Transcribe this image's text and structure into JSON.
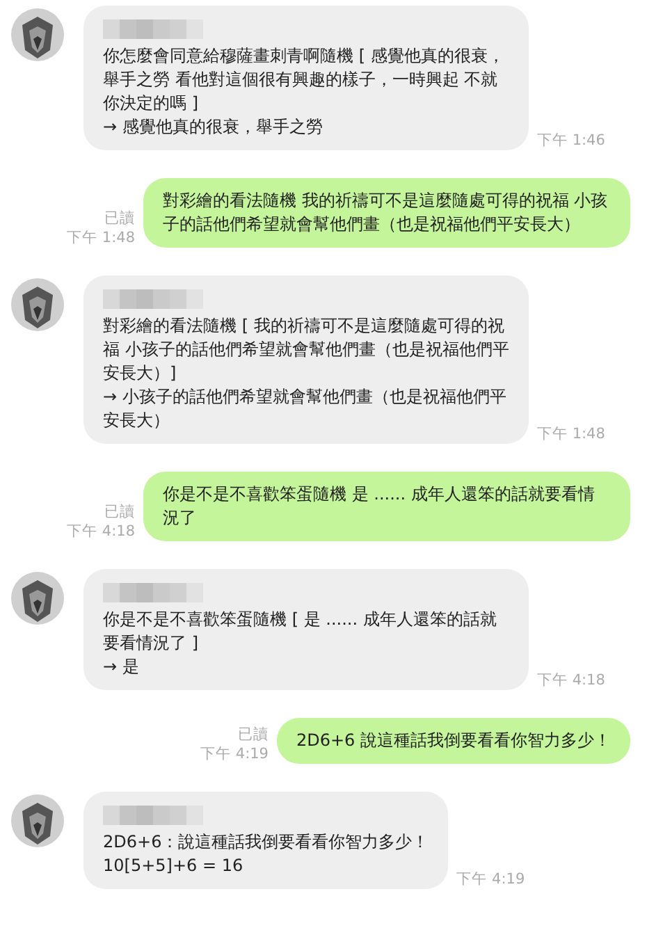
{
  "messages": [
    {
      "kind": "in",
      "lines": [
        "你怎麼會同意給穆薩畫刺青啊隨機 [ 感覺他真的很衰，舉手之勞 看他對這個很有興趣的樣子，一時興起 不就你決定的嗎 ]",
        "→ 感覺他真的很衰，舉手之勞"
      ],
      "time": "下午 1:46"
    },
    {
      "kind": "out",
      "lines": [
        "對彩繪的看法隨機 我的祈禱可不是這麼隨處可得的祝福 小孩子的話他們希望就會幫他們畫（也是祝福他們平安長大）"
      ],
      "read": "已讀",
      "time": "下午 1:48"
    },
    {
      "kind": "in",
      "lines": [
        "對彩繪的看法隨機 [ 我的祈禱可不是這麼隨處可得的祝福 小孩子的話他們希望就會幫他們畫（也是祝福他們平安長大）]",
        "→ 小孩子的話他們希望就會幫他們畫（也是祝福他們平安長大）"
      ],
      "time": "下午 1:48"
    },
    {
      "kind": "out",
      "lines": [
        "你是不是不喜歡笨蛋隨機 是 ...... 成年人還笨的話就要看情況了"
      ],
      "read": "已讀",
      "time": "下午 4:18"
    },
    {
      "kind": "in",
      "lines": [
        "你是不是不喜歡笨蛋隨機 [ 是 ...... 成年人還笨的話就要看情況了 ]",
        "→ 是"
      ],
      "time": "下午 4:18"
    },
    {
      "kind": "out",
      "lines": [
        "2D6+6 說這種話我倒要看看你智力多少！"
      ],
      "read": "已讀",
      "time": "下午 4:19"
    },
    {
      "kind": "in",
      "lines": [
        "2D6+6：說這種話我倒要看看你智力多少！",
        "10[5+5]+6 = 16"
      ],
      "time": "下午 4:19"
    }
  ]
}
